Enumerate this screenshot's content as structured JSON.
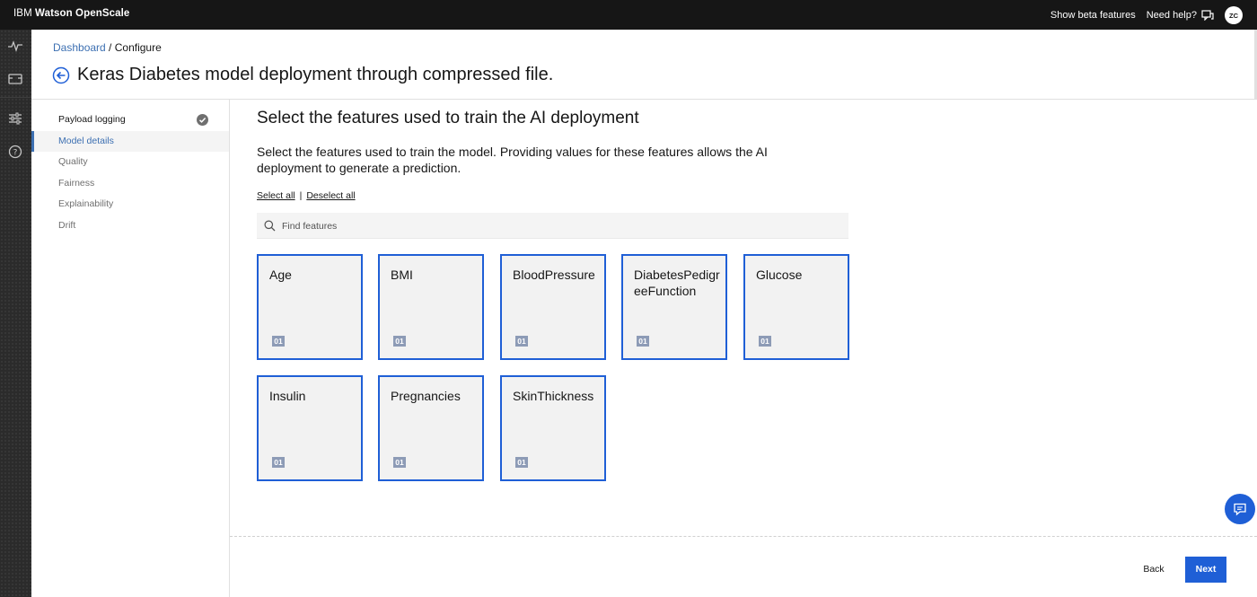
{
  "app": {
    "brand_prefix": "IBM",
    "brand_name": "Watson OpenScale",
    "show_beta": "Show beta features",
    "need_help": "Need help?",
    "avatar_initials": "ZC"
  },
  "breadcrumb": {
    "link": "Dashboard",
    "separator": " / ",
    "current": "Configure"
  },
  "page_title": "Keras Diabetes model deployment through compressed file.",
  "steps": [
    {
      "label": "Payload logging",
      "state": "done"
    },
    {
      "label": "Model details",
      "state": "active"
    },
    {
      "label": "Quality",
      "state": "pending"
    },
    {
      "label": "Fairness",
      "state": "pending"
    },
    {
      "label": "Explainability",
      "state": "pending"
    },
    {
      "label": "Drift",
      "state": "pending"
    }
  ],
  "main": {
    "title": "Select the features used to train the AI deployment",
    "description": "Select the features used to train the model. Providing values for these features allows the AI deployment to generate a prediction.",
    "select_all": "Select all",
    "separator": "|",
    "deselect_all": "Deselect all",
    "search_placeholder": "Find features"
  },
  "features": [
    {
      "name": "Age",
      "type_badge": "01",
      "selected": true
    },
    {
      "name": "BMI",
      "type_badge": "01",
      "selected": true
    },
    {
      "name": "BloodPressure",
      "type_badge": "01",
      "selected": true
    },
    {
      "name": "DiabetesPedigreeFunction",
      "type_badge": "01",
      "selected": true
    },
    {
      "name": "Glucose",
      "type_badge": "01",
      "selected": true
    },
    {
      "name": "Insulin",
      "type_badge": "01",
      "selected": true
    },
    {
      "name": "Pregnancies",
      "type_badge": "01",
      "selected": true
    },
    {
      "name": "SkinThickness",
      "type_badge": "01",
      "selected": true
    }
  ],
  "footer": {
    "back_label": "Back",
    "next_label": "Next"
  },
  "icons": {
    "rail": [
      "activity-icon",
      "deployment-icon",
      "settings-sliders-icon",
      "help-icon"
    ],
    "chat": "chat-icon"
  },
  "colors": {
    "accent": "#1f5fd6",
    "topbar": "#161616",
    "tile_bg": "#f2f2f2"
  }
}
